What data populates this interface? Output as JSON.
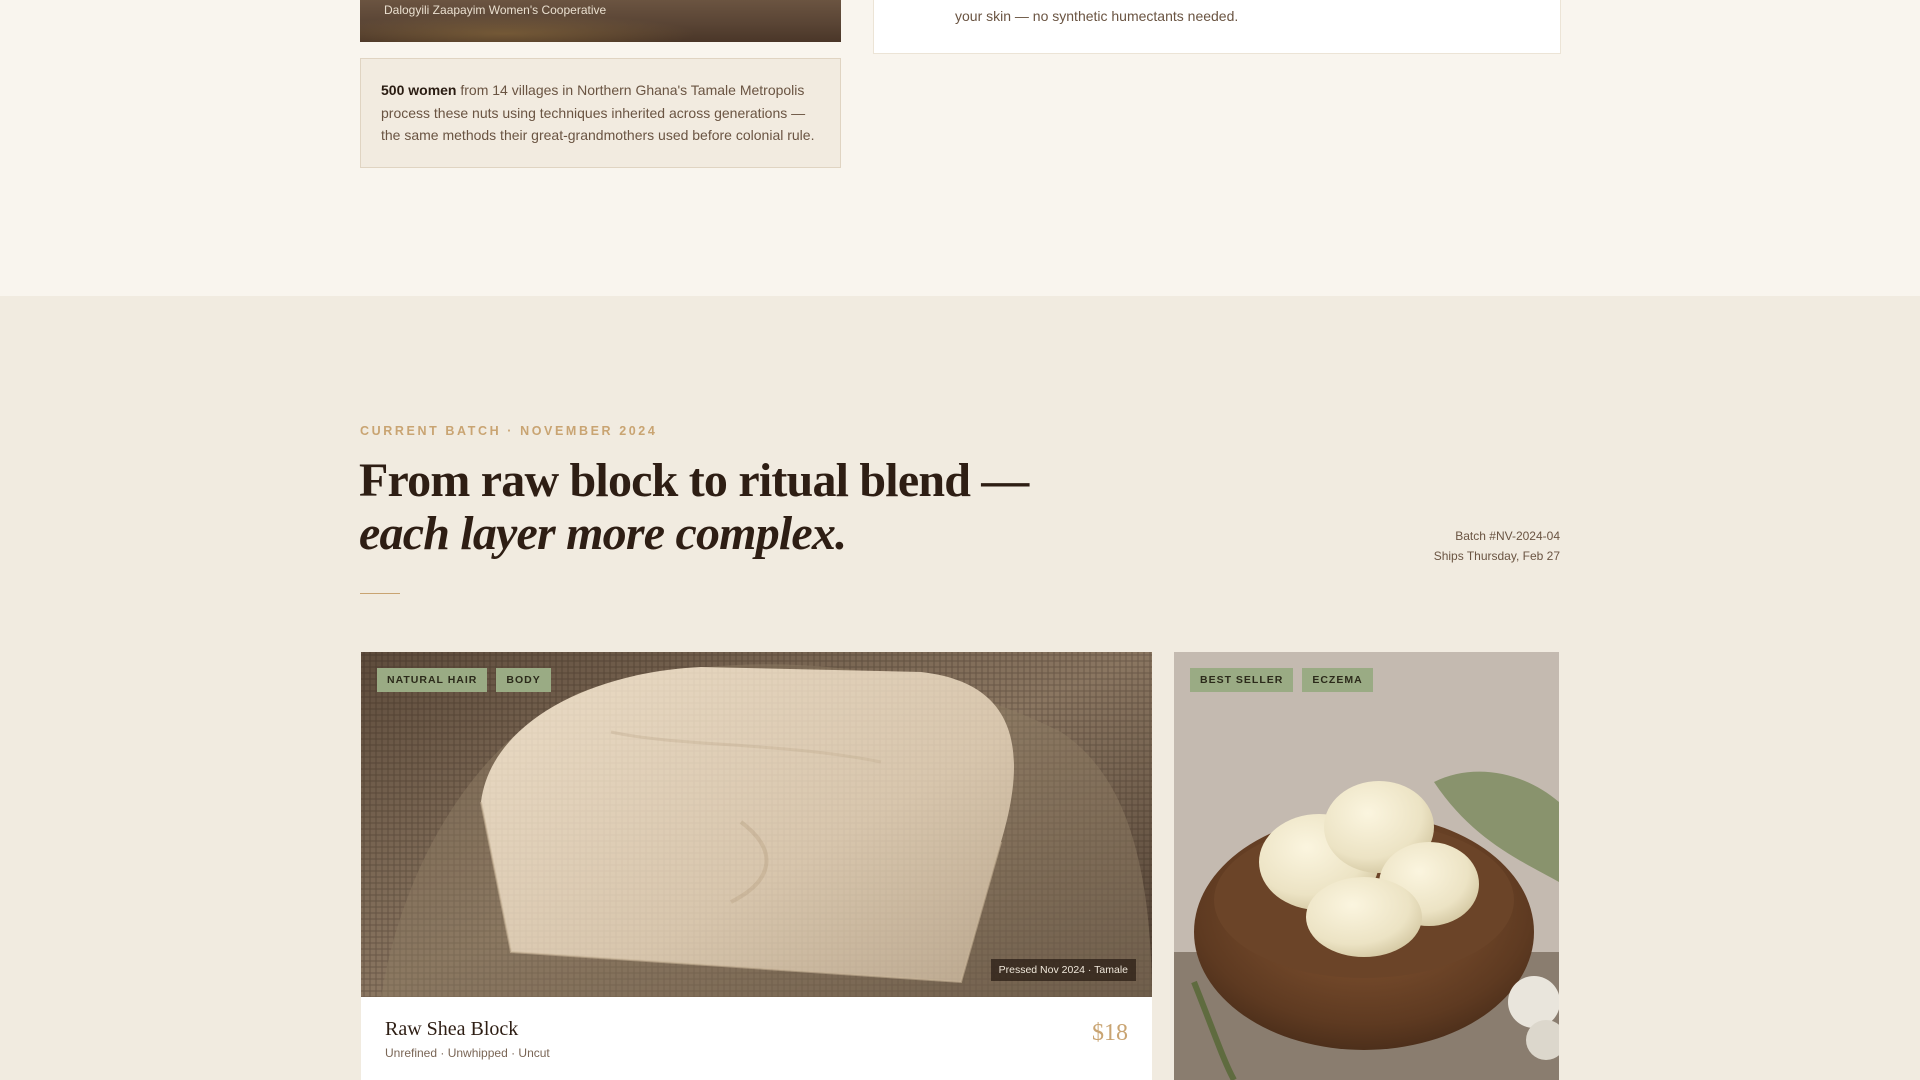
{
  "story": {
    "photo_caption": "Dalogyili Zaapayim Women's Cooperative",
    "quote_strong": "500 women",
    "quote_rest": " from 14 villages in Northern Ghana's Tamale Metropolis process these nuts using techniques inherited across generations — the same methods their great-grandmothers used before colonial rule.",
    "skin_line": "your skin — no synthetic humectants needed."
  },
  "batch": {
    "eyebrow": "CURRENT BATCH · NOVEMBER 2024",
    "headline_line1": "From raw block to ritual blend —",
    "headline_line2": "each layer more complex.",
    "batch_number": "Batch #NV-2024-04",
    "ships": "Ships Thursday, Feb 27"
  },
  "products": [
    {
      "tags": [
        "NATURAL HAIR",
        "BODY"
      ],
      "pressed": "Pressed Nov 2024 · Tamale",
      "name": "Raw Shea Block",
      "sub": "Unrefined · Unwhipped · Uncut",
      "price": "$18"
    },
    {
      "tags": [
        "BEST SELLER",
        "ECZEMA"
      ]
    }
  ],
  "colors": {
    "accent": "#c9a472",
    "tag_green": "#9aab84",
    "page_bg": "#f9f5ee",
    "section_bg": "#f1ebe0"
  }
}
